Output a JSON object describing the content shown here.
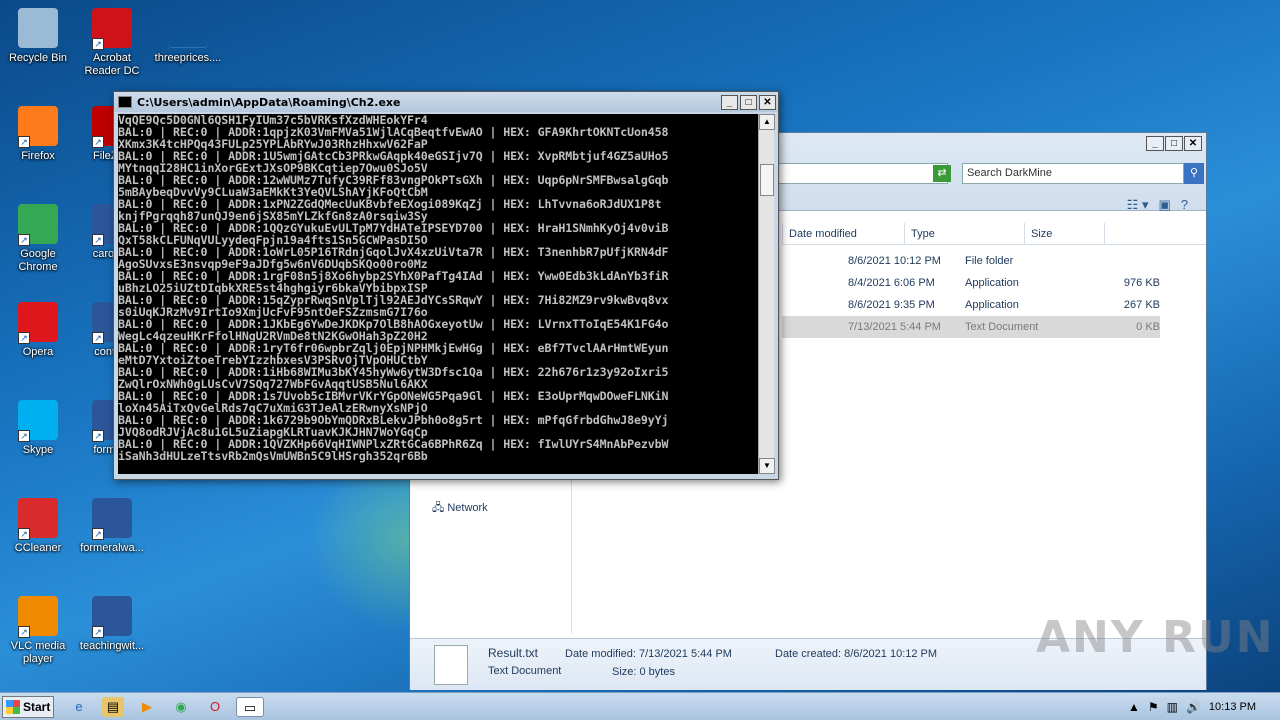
{
  "desktop": {
    "icons": [
      {
        "label": "Recycle Bin",
        "icon": "recycle-bin-icon",
        "color": "#9bbad6"
      },
      {
        "label": "Acrobat Reader DC",
        "icon": "acrobat-icon",
        "color": "#d0121b"
      },
      {
        "label": "threeprices....",
        "icon": "file-icon",
        "color": "#2f6db5"
      },
      {
        "label": "Firefox",
        "icon": "firefox-icon",
        "color": "#ff7a1a"
      },
      {
        "label": "FileZilla",
        "icon": "filezilla-icon",
        "color": "#bf0000"
      },
      {
        "label": "Google Chrome",
        "icon": "chrome-icon",
        "color": "#34a853"
      },
      {
        "label": "carolina",
        "icon": "word-doc-icon",
        "color": "#2b579a"
      },
      {
        "label": "Opera",
        "icon": "opera-icon",
        "color": "#e0161d"
      },
      {
        "label": "continu",
        "icon": "word-doc-icon",
        "color": "#2b579a"
      },
      {
        "label": "Skype",
        "icon": "skype-icon",
        "color": "#00aff0"
      },
      {
        "label": "formatp",
        "icon": "word-doc-icon",
        "color": "#2b579a"
      },
      {
        "label": "CCleaner",
        "icon": "ccleaner-icon",
        "color": "#d92b2b"
      },
      {
        "label": "formeralwa...",
        "icon": "word-doc-icon",
        "color": "#2b579a"
      },
      {
        "label": "VLC media player",
        "icon": "vlc-icon",
        "color": "#f08a00"
      },
      {
        "label": "teachingwit...",
        "icon": "word-doc-icon",
        "color": "#2b579a"
      }
    ]
  },
  "console": {
    "title": "C:\\Users\\admin\\AppData\\Roaming\\Ch2.exe",
    "lines": [
      "VqQE9Qc5D0GNl6QSH1FyIUm37c5bVRKsfXzdWHEokYFr4",
      "BAL:0 | REC:0 | ADDR:1qpjzK03VmFMVa51WjlACqBeqtfvEwAO | HEX: GFA9KhrtOKNTcUon458",
      "XKmx3K4tcHPQq43FULp25YPLAbRYwJ03RhzHhxwV62FaP",
      "BAL:0 | REC:0 | ADDR:1U5wmjGAtcCb3PRkwGAqpk40eGSIjv7Q | HEX: XvpRMbtjuf4GZ5aUHo5",
      "MYtnqqI28HC1inXorGExtJXsOP9BKCqtiep7Owu0SJo5V",
      "BAL:0 | REC:0 | ADDR:12wWUMz7TufyC39RFf83vngPOkPTsGXh | HEX: Uqp6pNrSMFBwsalgGqb",
      "5mBAybeqDvvVy9CLuaW3aEMkKt3YeQVLShAYjKFoQtCbM",
      "BAL:0 | REC:0 | ADDR:1xPN2ZGdQMecUuKBvbfeEXogi089KqZj | HEX: LhTvvna6oRJdUX1P8t",
      "knjfPgrqqh87unQJ9en6jSX85mYLZkfGn8zA0rsqiw3Sy",
      "BAL:0 | REC:0 | ADDR:1QQzGYukuEvULTpM7YdHATeIPSEYD700 | HEX: HraH1SNmhKyOj4v0viB",
      "QxT58kCLFUNqVULyydeqFpjn19a4fts1Sn5GCWPasDI5O",
      "BAL:0 | REC:0 | ADDR:1oWrL05P16TRdnjGqolJvX4xzUiVta7R | HEX: T3nenhbR7pUfjKRN4dF",
      "AgoSUvxsE3nsvqp9eF9aJDfg5w6nV6DUqbSKQo00ro0Mz",
      "BAL:0 | REC:0 | ADDR:1rgF08n5j8Xo6hybp2SYhX0PafTg4IAd | HEX: Yww0Edb3kLdAnYb3fiR",
      "uBhzLO25iUZtDIqbkXRE5st4hghgiyr6bkaVYbibpxISP",
      "BAL:0 | REC:0 | ADDR:15qZyprRwqSnVplTjl92AEJdYCsSRqwY | HEX: 7Hi82MZ9rv9kwBvq8vx",
      "s0iUqKJRzMv9IrtIo9XmjUcFvF95ntOeFSZzmsmG7I76o",
      "BAL:0 | REC:0 | ADDR:1JKbEg6YwDeJKDKp7OlB8hAOGxeyotUw | HEX: LVrnxTToIqE54K1FG4o",
      "WegLc4qzeuHKrFfolHNgU2RVmDe8tN2KGwOHah3pZ20H2",
      "BAL:0 | REC:0 | ADDR:1ryT6fr06wpbrZqlj0EpjNPHMkjEwHGg | HEX: eBf7TvclAArHmtWEyun",
      "eMtD7YxtoiZtoeTrebYIzzhbxesV3PSRvOjTVpOHUCtbY",
      "BAL:0 | REC:0 | ADDR:1iHb68WIMu3bKY45hyWw6ytW3Dfsc1Qa | HEX: 22h676r1z3y92oIxri5",
      "ZwQlrOxNWh0gLUsCvV7SQq727WbFGvAqqtUSB5Nul6AKX",
      "BAL:0 | REC:0 | ADDR:1s7Uvob5cIBMvrVKrYGpONeWG5Pqa9Gl | HEX: E3oUprMqwDOweFLNKiN",
      "loXn45AiTxQvGelRds7qC7uXmiG3TJeAlzERwnyXsNPjO",
      "BAL:0 | REC:0 | ADDR:1k6729b9ObYmQDRxBLekvJPbh0o8g5rt | HEX: mPfqGfrbdGhwJ8e9yYj",
      "JVQ8odRJVjAc8u1GL5uZiapgKLRTuavKJKJHN7WoYGqCp",
      "BAL:0 | REC:0 | ADDR:1QVZKHp66VqHIWNPlxZRtGCa6BPhR6Zq | HEX: fIwlUYrS4MnAbPezvbW",
      "iSaNh3dHULzeTtsvRb2mQsVmUWBn5C9lHSrgh352qr6Bb"
    ]
  },
  "explorer": {
    "search_placeholder": "Search DarkMine",
    "columns": [
      "Date modified",
      "Type",
      "Size"
    ],
    "rows": [
      {
        "date": "8/6/2021 10:12 PM",
        "type": "File folder",
        "size": ""
      },
      {
        "date": "8/4/2021 6:06 PM",
        "type": "Application",
        "size": "976 KB"
      },
      {
        "date": "8/6/2021 9:35 PM",
        "type": "Application",
        "size": "267 KB"
      },
      {
        "date": "7/13/2021 5:44 PM",
        "type": "Text Document",
        "size": "0 KB"
      }
    ],
    "nav_network": "Network",
    "details": {
      "filename": "Result.txt",
      "filetype": "Text Document",
      "date_modified": "Date modified: 7/13/2021 5:44 PM",
      "size": "Size: 0 bytes",
      "date_created": "Date created: 8/6/2021 10:12 PM"
    }
  },
  "watermark": "ANY RUN",
  "taskbar": {
    "start_label": "Start",
    "clock": "10:13 PM"
  }
}
